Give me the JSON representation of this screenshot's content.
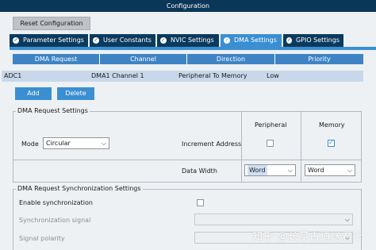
{
  "window": {
    "title": "Configuration"
  },
  "toolbar": {
    "reset_label": "Reset Configuration"
  },
  "tabs": [
    {
      "label": "Parameter Settings",
      "icon": "check-circle-icon",
      "active": false
    },
    {
      "label": "User Constants",
      "icon": "check-circle-icon",
      "active": false
    },
    {
      "label": "NVIC Settings",
      "icon": "check-circle-icon",
      "active": false
    },
    {
      "label": "DMA Settings",
      "icon": "check-circle-icon",
      "active": true
    },
    {
      "label": "GPIO Settings",
      "icon": "check-circle-icon",
      "active": false
    }
  ],
  "dma_table": {
    "headers": [
      "DMA Request",
      "Channel",
      "Direction",
      "Priority"
    ],
    "rows": [
      [
        "ADC1",
        "DMA1 Channel 1",
        "Peripheral To Memory",
        "Low"
      ]
    ]
  },
  "actions": {
    "add_label": "Add",
    "delete_label": "Delete"
  },
  "request_settings": {
    "title": "DMA Request Settings",
    "col_peripheral": "Peripheral",
    "col_memory": "Memory",
    "mode_label": "Mode",
    "mode_value": "Circular",
    "increment_label": "Increment Address",
    "peripheral_increment": false,
    "memory_increment": true,
    "data_width_label": "Data Width",
    "peripheral_width": "Word",
    "memory_width": "Word"
  },
  "sync_settings": {
    "title": "DMA Request Synchronization Settings",
    "enable_label": "Enable synchronization",
    "enable_checked": false,
    "signal_label": "Synchronization signal",
    "polarity_label": "Signal polarity"
  },
  "watermark": {
    "text": "知乎 @长亭古道送君行"
  },
  "colors": {
    "title_bar": "#0a3657",
    "tab": "#0b3a5e",
    "tab_active": "#3b8fd1",
    "table_header": "#3e84c4",
    "row_selected": "#c8d8ea"
  }
}
